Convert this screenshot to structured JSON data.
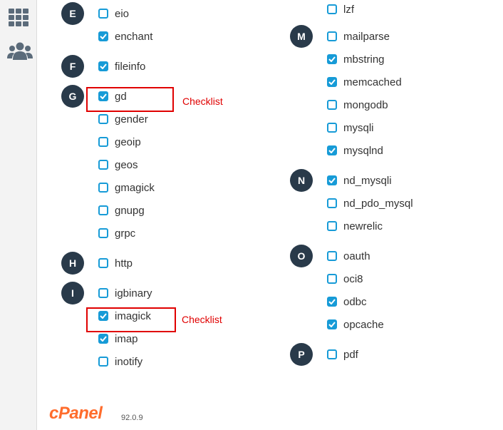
{
  "sidebar": {
    "icons": [
      "grid-icon",
      "users-icon"
    ]
  },
  "columns": [
    {
      "groups": [
        {
          "letter": "E",
          "items": [
            {
              "label": "eio",
              "checked": false
            },
            {
              "label": "enchant",
              "checked": true
            }
          ]
        },
        {
          "letter": "F",
          "items": [
            {
              "label": "fileinfo",
              "checked": true
            }
          ]
        },
        {
          "letter": "G",
          "items": [
            {
              "label": "gd",
              "checked": true
            },
            {
              "label": "gender",
              "checked": false
            },
            {
              "label": "geoip",
              "checked": false
            },
            {
              "label": "geos",
              "checked": false
            },
            {
              "label": "gmagick",
              "checked": false
            },
            {
              "label": "gnupg",
              "checked": false
            },
            {
              "label": "grpc",
              "checked": false
            }
          ]
        },
        {
          "letter": "H",
          "items": [
            {
              "label": "http",
              "checked": false
            }
          ]
        },
        {
          "letter": "I",
          "items": [
            {
              "label": "igbinary",
              "checked": false
            },
            {
              "label": "imagick",
              "checked": true
            },
            {
              "label": "imap",
              "checked": true
            },
            {
              "label": "inotify",
              "checked": false
            }
          ]
        }
      ]
    },
    {
      "groups": [
        {
          "letter": "",
          "items": [
            {
              "label": "lzf",
              "checked": false
            }
          ]
        },
        {
          "letter": "M",
          "items": [
            {
              "label": "mailparse",
              "checked": false
            },
            {
              "label": "mbstring",
              "checked": true
            },
            {
              "label": "memcached",
              "checked": true
            },
            {
              "label": "mongodb",
              "checked": false
            },
            {
              "label": "mysqli",
              "checked": false
            },
            {
              "label": "mysqlnd",
              "checked": true
            }
          ]
        },
        {
          "letter": "N",
          "items": [
            {
              "label": "nd_mysqli",
              "checked": true
            },
            {
              "label": "nd_pdo_mysql",
              "checked": false
            },
            {
              "label": "newrelic",
              "checked": false
            }
          ]
        },
        {
          "letter": "O",
          "items": [
            {
              "label": "oauth",
              "checked": false
            },
            {
              "label": "oci8",
              "checked": false
            },
            {
              "label": "odbc",
              "checked": true
            },
            {
              "label": "opcache",
              "checked": true
            }
          ]
        },
        {
          "letter": "P",
          "items": [
            {
              "label": "pdf",
              "checked": false
            }
          ]
        }
      ]
    }
  ],
  "annotations": [
    {
      "text": "Checklist"
    },
    {
      "text": "Checklist"
    }
  ],
  "footer": {
    "logo": "cPanel",
    "version": "92.0.9"
  }
}
